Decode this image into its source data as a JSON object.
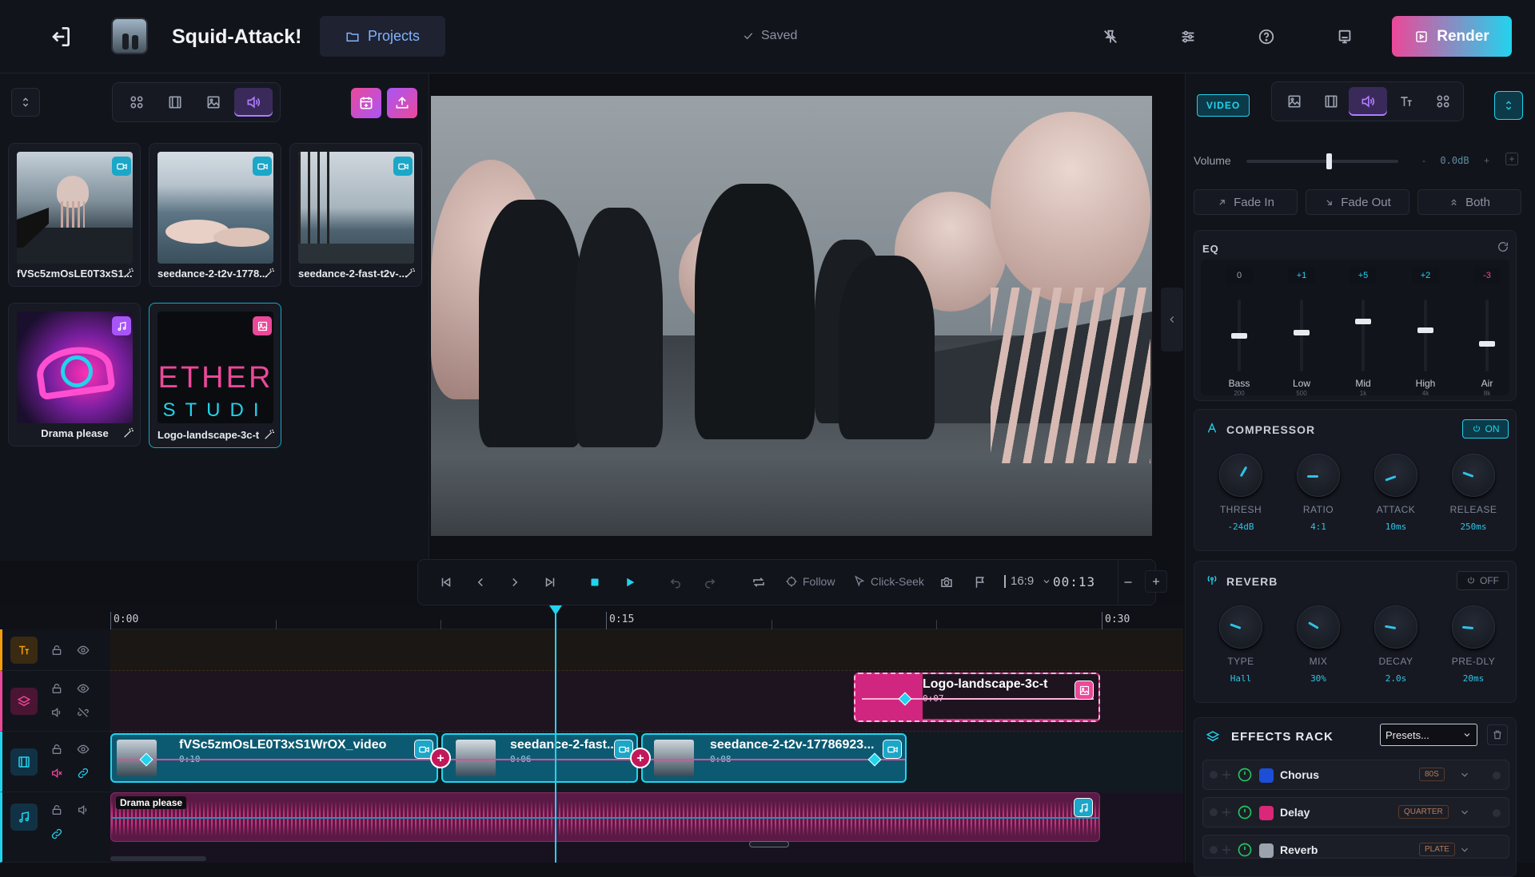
{
  "header": {
    "project_title": "Squid-Attack!",
    "projects_label": "Projects",
    "saved_label": "Saved",
    "render_label": "Render"
  },
  "media": {
    "items": [
      {
        "name": "fVSc5zmOsLE0T3xS1...",
        "type": "video"
      },
      {
        "name": "seedance-2-t2v-1778...",
        "type": "video"
      },
      {
        "name": "seedance-2-fast-t2v-...",
        "type": "video"
      },
      {
        "name": "Drama please",
        "type": "audio"
      },
      {
        "name": "Logo-landscape-3c-t",
        "type": "image"
      }
    ],
    "logo_text_top": "ETHER",
    "logo_text_bottom": "STUDI"
  },
  "transport": {
    "follow_label": "Follow",
    "clickseek_label": "Click-Seek",
    "aspect": "16:9",
    "timecode": "00:13"
  },
  "timeline": {
    "ruler": [
      "0:00",
      "0:15",
      "0:30"
    ],
    "clips": {
      "logo": {
        "name": "Logo-landscape-3c-t",
        "time": "0:07"
      },
      "v1": {
        "name": "fVSc5zmOsLE0T3xS1WrOX_video",
        "time": "0:10"
      },
      "v2": {
        "name": "seedance-2-fast...",
        "time": "0:06"
      },
      "v3": {
        "name": "seedance-2-t2v-17786923...",
        "time": "0:08"
      },
      "audio": {
        "name": "Drama please"
      }
    },
    "playhead_fraction": 0.43
  },
  "inspector": {
    "tab_label": "VIDEO",
    "volume_label": "Volume",
    "volume_value": "0.0dB",
    "fade_in": "Fade In",
    "fade_out": "Fade Out",
    "fade_both": "Both",
    "eq_title": "EQ",
    "eq_bands": [
      {
        "label": "Bass",
        "freq": "200",
        "gain": "0",
        "level": 0.5
      },
      {
        "label": "Low",
        "freq": "500",
        "gain": "+1",
        "level": 0.55
      },
      {
        "label": "Mid",
        "freq": "1k",
        "gain": "+5",
        "level": 0.75
      },
      {
        "label": "High",
        "freq": "4k",
        "gain": "+2",
        "level": 0.6
      },
      {
        "label": "Air",
        "freq": "8k",
        "gain": "-3",
        "level": 0.35
      }
    ],
    "compressor": {
      "title": "COMPRESSOR",
      "toggle": "ON",
      "knobs": [
        {
          "label": "THRESH",
          "value": "-24dB"
        },
        {
          "label": "RATIO",
          "value": "4:1"
        },
        {
          "label": "ATTACK",
          "value": "10ms"
        },
        {
          "label": "RELEASE",
          "value": "250ms"
        }
      ]
    },
    "reverb": {
      "title": "REVERB",
      "toggle": "OFF",
      "knobs": [
        {
          "label": "TYPE",
          "value": "Hall"
        },
        {
          "label": "MIX",
          "value": "30%"
        },
        {
          "label": "DECAY",
          "value": "2.0s"
        },
        {
          "label": "PRE-DLY",
          "value": "20ms"
        }
      ]
    },
    "effects_rack": {
      "title": "EFFECTS RACK",
      "presets_label": "Presets...",
      "items": [
        {
          "name": "Chorus",
          "tag": "80S"
        },
        {
          "name": "Delay",
          "tag": "QUARTER"
        },
        {
          "name": "Reverb",
          "tag": "PLATE"
        }
      ]
    }
  },
  "colors": {
    "accent_cyan": "#2ec4e6",
    "accent_pink": "#e83e8c",
    "accent_purple": "#b07cff",
    "render_gradient_from": "#ec4899",
    "render_gradient_to": "#22d3ee"
  }
}
